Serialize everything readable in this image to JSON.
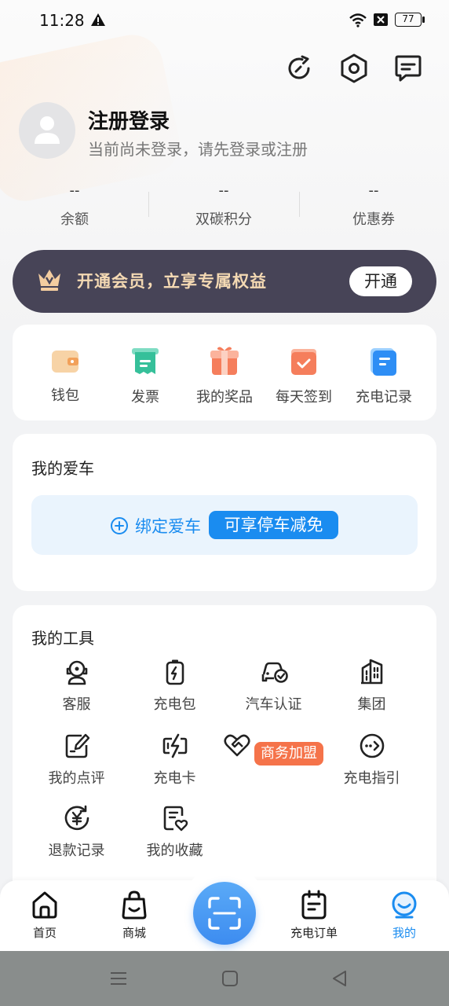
{
  "status_bar": {
    "time": "11:28",
    "battery": "77"
  },
  "profile": {
    "name": "注册登录",
    "subtitle": "当前尚未登录，请先登录或注册"
  },
  "stats": [
    {
      "value": "--",
      "label": "余额"
    },
    {
      "value": "--",
      "label": "双碳积分"
    },
    {
      "value": "--",
      "label": "优惠券"
    }
  ],
  "vip": {
    "text": "开通会员，立享专属权益",
    "button": "开通"
  },
  "quick": [
    {
      "label": "钱包",
      "icon": "wallet-icon"
    },
    {
      "label": "发票",
      "icon": "invoice-icon"
    },
    {
      "label": "我的奖品",
      "icon": "gift-icon"
    },
    {
      "label": "每天签到",
      "icon": "checkin-icon"
    },
    {
      "label": "充电记录",
      "icon": "charge-record-icon"
    }
  ],
  "car": {
    "title": "我的爱车",
    "bind": "绑定爱车",
    "badge": "可享停车减免"
  },
  "tools": {
    "title": "我的工具",
    "items": [
      {
        "label": "客服",
        "icon": "customer-service-icon"
      },
      {
        "label": "充电包",
        "icon": "charge-pack-icon"
      },
      {
        "label": "汽车认证",
        "icon": "car-certify-icon"
      },
      {
        "label": "集团",
        "icon": "group-icon"
      },
      {
        "label": "我的点评",
        "icon": "review-icon"
      },
      {
        "label": "充电卡",
        "icon": "charge-card-icon"
      },
      {
        "label": "商务加盟",
        "icon": "business-join-icon"
      },
      {
        "label": "充电指引",
        "icon": "charge-guide-icon"
      },
      {
        "label": "退款记录",
        "icon": "refund-icon"
      },
      {
        "label": "我的收藏",
        "icon": "favorites-icon"
      }
    ]
  },
  "nav": [
    {
      "label": "首页",
      "icon": "home-icon"
    },
    {
      "label": "商城",
      "icon": "shop-icon"
    },
    {
      "label": "",
      "icon": "scan-icon"
    },
    {
      "label": "充电订单",
      "icon": "order-icon"
    },
    {
      "label": "我的",
      "icon": "profile-icon"
    }
  ],
  "colors": {
    "accent": "#1a8cf0",
    "vip_bg": "#474457",
    "vip_text": "#f4d9b3",
    "business_badge": "#f5734a"
  }
}
